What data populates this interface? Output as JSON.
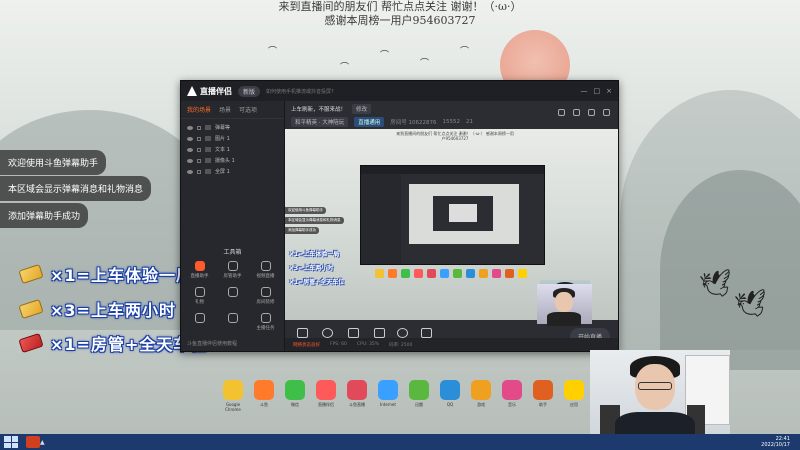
{
  "top_banner": {
    "line1": "来到直播间的朋友们 帮忙点点关注 谢谢！（·ω·）",
    "line2": "感谢本周榜一用户954603727"
  },
  "notifications": [
    "欢迎使用斗鱼弹幕助手",
    "本区域会显示弹幕消息和礼物消息",
    "添加弹幕助手成功"
  ],
  "gift_rules": [
    {
      "icon": "ticket-icon",
      "text": "×1=上车体验一局"
    },
    {
      "icon": "ticket-icon",
      "text": "×3=上车两小时"
    },
    {
      "icon": "plane-icon",
      "text": "×1=房管+全天车位"
    }
  ],
  "app": {
    "logo": "直播伴侣",
    "version_pill": "新版",
    "notice": "如何使用手机推流或抖音投屏?",
    "window_controls": [
      "—",
      "□",
      "×"
    ],
    "tabs": [
      {
        "label": "我的场景",
        "active": true
      },
      {
        "label": "场景",
        "active": false
      },
      {
        "label": "可选项",
        "active": false
      }
    ],
    "layers": [
      "弹幕等",
      "图片 1",
      "文本 1",
      "摄像头 1",
      "全屏 1"
    ],
    "tools_title": "工具箱",
    "tools": [
      {
        "label": "直播助手",
        "hot": true
      },
      {
        "label": "房管助手",
        "hot": false
      },
      {
        "label": "视频直播",
        "hot": false
      },
      {
        "label": "礼物",
        "hot": false
      },
      {
        "label": "",
        "hot": false
      },
      {
        "label": "房间装修",
        "hot": false
      },
      {
        "label": "",
        "hot": false
      },
      {
        "label": "",
        "hot": false
      },
      {
        "label": "主播任务",
        "hot": false
      },
      {
        "label": "",
        "hot": false
      },
      {
        "label": "",
        "hot": false
      },
      {
        "label": "",
        "hot": false
      }
    ],
    "rescue_text": "斗鱼直播伴侣使用教程",
    "room": {
      "title": "上车刷新，不服来战！",
      "edit": "修改",
      "category": "和平精英 · 大神陪玩",
      "status_tag": "直播通用",
      "room_info": "房间号 10622876",
      "fans": "15552",
      "viewers": "21"
    },
    "preview": {
      "text": "来到直播间的朋友们 帮忙点点关注 谢谢！（·ω·） 感谢本周榜一用户954603727",
      "mini_msgs": [
        "欢迎使用斗鱼弹幕助手",
        "本区域会显示弹幕消息和礼物消息",
        "添加弹幕助手成功"
      ],
      "mini_gifts": [
        "×1=上车体验一局",
        "×3=上车两小时",
        "×1=房管+全天车位"
      ]
    },
    "toolbar": [
      {
        "label": "直播屏幕",
        "icon": "screen-icon"
      },
      {
        "label": "摄像头",
        "icon": "camera-icon"
      },
      {
        "label": "手机投屏",
        "icon": "phone-cast-icon"
      },
      {
        "label": "多媒体",
        "icon": "media-icon"
      },
      {
        "label": "麦克风",
        "icon": "mic-icon"
      },
      {
        "label": "扬声器",
        "icon": "speaker-icon"
      }
    ],
    "start_button": "开始直播",
    "status_bar": {
      "alert": "网络状态良好",
      "fps": "FPS: 60",
      "cpu": "CPU: 35%",
      "bitrate": "码率: 2500"
    }
  },
  "desktop_icons": [
    {
      "label": "Google Chrome",
      "color": "#f2c230"
    },
    {
      "label": "斗鱼",
      "color": "#ff7a2a"
    },
    {
      "label": "微信",
      "color": "#3fbf4a"
    },
    {
      "label": "直播伴侣",
      "color": "#ff5a5a"
    },
    {
      "label": "斗鱼直播",
      "color": "#e04a5a"
    },
    {
      "label": "Internet",
      "color": "#3aa0ff"
    },
    {
      "label": "迅雷",
      "color": "#5ab840"
    },
    {
      "label": "QQ",
      "color": "#2a8fd8"
    },
    {
      "label": "游戏",
      "color": "#f0a020"
    },
    {
      "label": "音乐",
      "color": "#e24a8a"
    },
    {
      "label": "助手",
      "color": "#e06020"
    },
    {
      "label": "应用",
      "color": "#ffd000"
    }
  ],
  "taskbar": {
    "time": "22:41",
    "date": "2022/10/17"
  }
}
